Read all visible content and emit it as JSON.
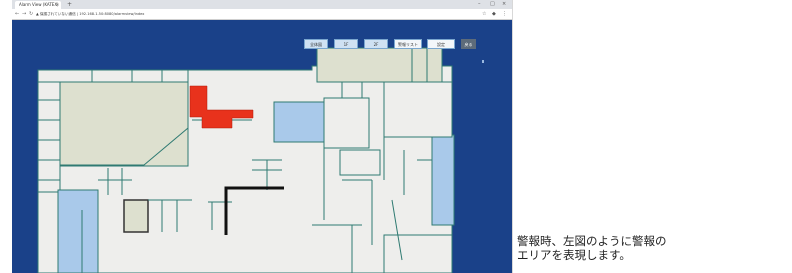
{
  "browser": {
    "tab_title": "Alarm View (KATEX)",
    "tab_close": "×",
    "new_tab": "+",
    "url": "▲ 保護されていない通信 | 192.168.1.50:8080/alarmview/index",
    "window_controls": [
      "–",
      "□",
      "×"
    ]
  },
  "toolbar": {
    "buttons": [
      {
        "label": "全体図",
        "style": "blue"
      },
      {
        "label": "1F",
        "style": "blue"
      },
      {
        "label": "2F",
        "style": "blue"
      },
      {
        "label": "警報リスト",
        "style": "white"
      },
      {
        "label": "設定",
        "style": "white"
      },
      {
        "label": "戻る",
        "style": "dark"
      }
    ]
  },
  "floor_plan": {
    "alarm_area_color": "#e8321c",
    "room_fill": "#dde0cf",
    "blue_fill": "#a9c9ea",
    "corridor_fill": "#eeeeec",
    "wall_color": "#2f7a72",
    "background": "#1a4189"
  },
  "caption": {
    "line1": "警報時、左図のように警報の",
    "line2": "エリアを表現します。"
  }
}
